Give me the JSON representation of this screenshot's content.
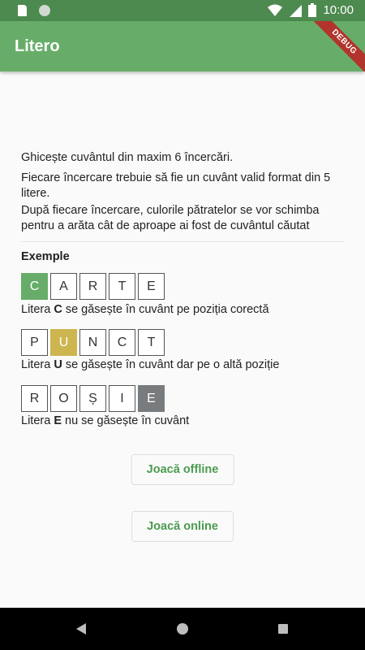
{
  "status_bar": {
    "time": "10:00"
  },
  "app_bar": {
    "title": "Litero",
    "debug_banner": "DEBUG"
  },
  "intro": {
    "line1": "Ghicește cuvântul din maxim 6 încercări.",
    "line2": "Fiecare încercare trebuie să fie un cuvânt valid format din 5 litere.",
    "line3": "După fiecare încercare, culorile pătratelor se vor schimba pentru a arăta cât de aproape ai fost de cuvântul căutat"
  },
  "examples": {
    "title": "Exemple",
    "items": [
      {
        "letters": [
          "C",
          "A",
          "R",
          "T",
          "E"
        ],
        "states": [
          "correct",
          "none",
          "none",
          "none",
          "none"
        ],
        "caption_prefix": "Litera ",
        "caption_letter": "C",
        "caption_suffix": " se găsește în cuvânt pe poziția corectă"
      },
      {
        "letters": [
          "P",
          "U",
          "N",
          "C",
          "T"
        ],
        "states": [
          "none",
          "present",
          "none",
          "none",
          "none"
        ],
        "caption_prefix": "Litera ",
        "caption_letter": "U",
        "caption_suffix": " se găsește în cuvânt dar pe o altă poziție"
      },
      {
        "letters": [
          "R",
          "O",
          "Ș",
          "I",
          "E"
        ],
        "states": [
          "none",
          "none",
          "none",
          "none",
          "absent"
        ],
        "caption_prefix": "Litera ",
        "caption_letter": "E",
        "caption_suffix": " nu se găsește în cuvânt"
      }
    ]
  },
  "buttons": {
    "offline": "Joacă offline",
    "online": "Joacă online"
  },
  "colors": {
    "accent": "#67ad69",
    "correct": "#67ad69",
    "present": "#cdb64f",
    "absent": "#797c7e"
  },
  "icons": [
    "sd-card-icon",
    "notification-icon",
    "wifi-icon",
    "signal-icon",
    "battery-icon",
    "back-icon",
    "home-icon",
    "recents-icon"
  ]
}
